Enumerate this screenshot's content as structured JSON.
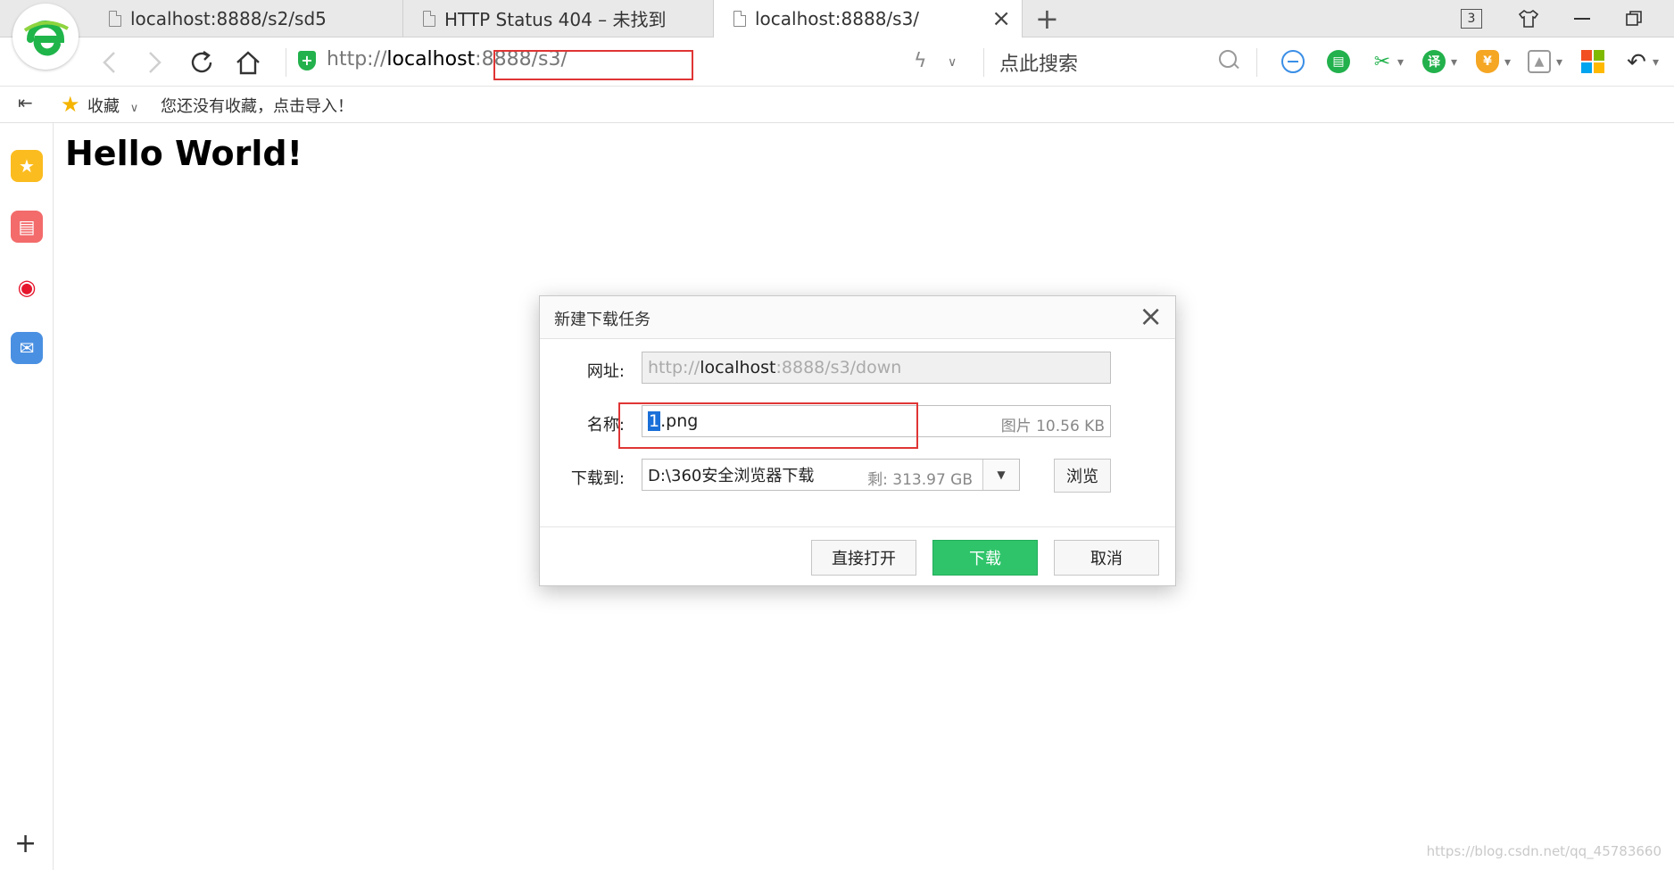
{
  "tabs": [
    {
      "label": "localhost:8888/s2/sd5",
      "active": false
    },
    {
      "label": "HTTP Status 404 – 未找到",
      "active": false
    },
    {
      "label": "localhost:8888/s3/",
      "active": true
    }
  ],
  "tab_count": "3",
  "address": {
    "scheme": "http://",
    "host": "localhost",
    "port": ":8888",
    "path": "/s3/"
  },
  "search": {
    "placeholder": "点此搜索"
  },
  "bookmarks": {
    "label": "收藏",
    "hint": "您还没有收藏，点击导入！"
  },
  "page": {
    "heading": "Hello World!"
  },
  "dialog": {
    "title": "新建下载任务",
    "url_label": "网址:",
    "url_scheme": "http://",
    "url_host": "localhost",
    "url_rest": ":8888/s3/down",
    "name_label": "名称:",
    "name_selected": "1",
    "name_rest": ".png",
    "file_meta": "图片 10.56 KB",
    "dest_label": "下载到:",
    "dest_path": "D:\\360安全浏览器下载",
    "dest_free": "剩: 313.97 GB",
    "browse_label": "浏览",
    "open_label": "直接打开",
    "download_label": "下载",
    "cancel_label": "取消"
  },
  "colors": {
    "accent_green": "#2fc46a",
    "highlight_red": "#e03535",
    "selection_blue": "#1a6fd8"
  },
  "icons": [
    "browser-logo-icon",
    "document-icon",
    "close-icon",
    "plus-icon",
    "back-icon",
    "forward-icon",
    "refresh-icon",
    "home-icon",
    "shield-icon",
    "bolt-icon",
    "search-icon",
    "star-icon",
    "news-icon",
    "weibo-icon",
    "mail-icon"
  ],
  "watermark": "https://blog.csdn.net/qq_45783660"
}
